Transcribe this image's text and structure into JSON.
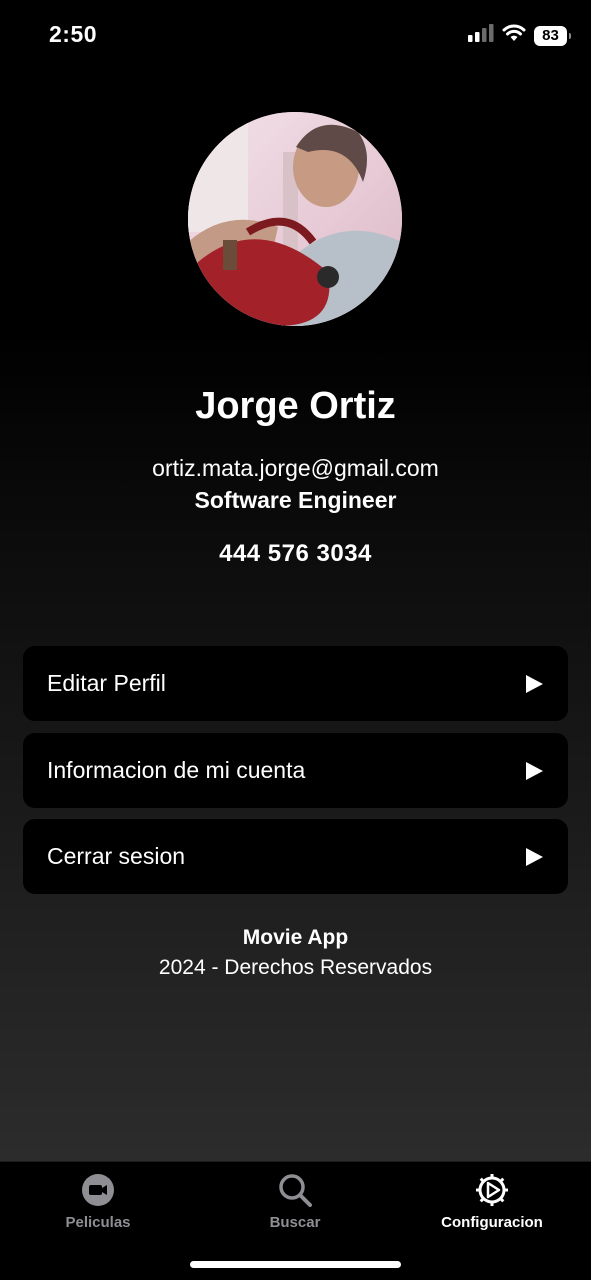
{
  "status_bar": {
    "time": "2:50",
    "battery": "83"
  },
  "profile": {
    "name": "Jorge Ortiz",
    "email": "ortiz.mata.jorge@gmail.com",
    "job_title": "Software Engineer",
    "phone": "444 576 3034"
  },
  "menu": {
    "items": [
      {
        "label": "Editar Perfil",
        "icon": "play-icon"
      },
      {
        "label": "Informacion de mi cuenta",
        "icon": "play-icon"
      },
      {
        "label": "Cerrar sesion",
        "icon": "play-icon"
      }
    ]
  },
  "footer": {
    "title": "Movie App",
    "subtitle": "2024 - Derechos Reservados"
  },
  "tab_bar": {
    "tabs": [
      {
        "label": "Peliculas",
        "icon": "video-camera-icon",
        "active": false
      },
      {
        "label": "Buscar",
        "icon": "search-icon",
        "active": false
      },
      {
        "label": "Configuracion",
        "icon": "gear-icon",
        "active": true
      }
    ]
  },
  "colors": {
    "background": "#000000",
    "card": "#000000",
    "text": "#ffffff",
    "tab_inactive": "#8e8e93"
  }
}
